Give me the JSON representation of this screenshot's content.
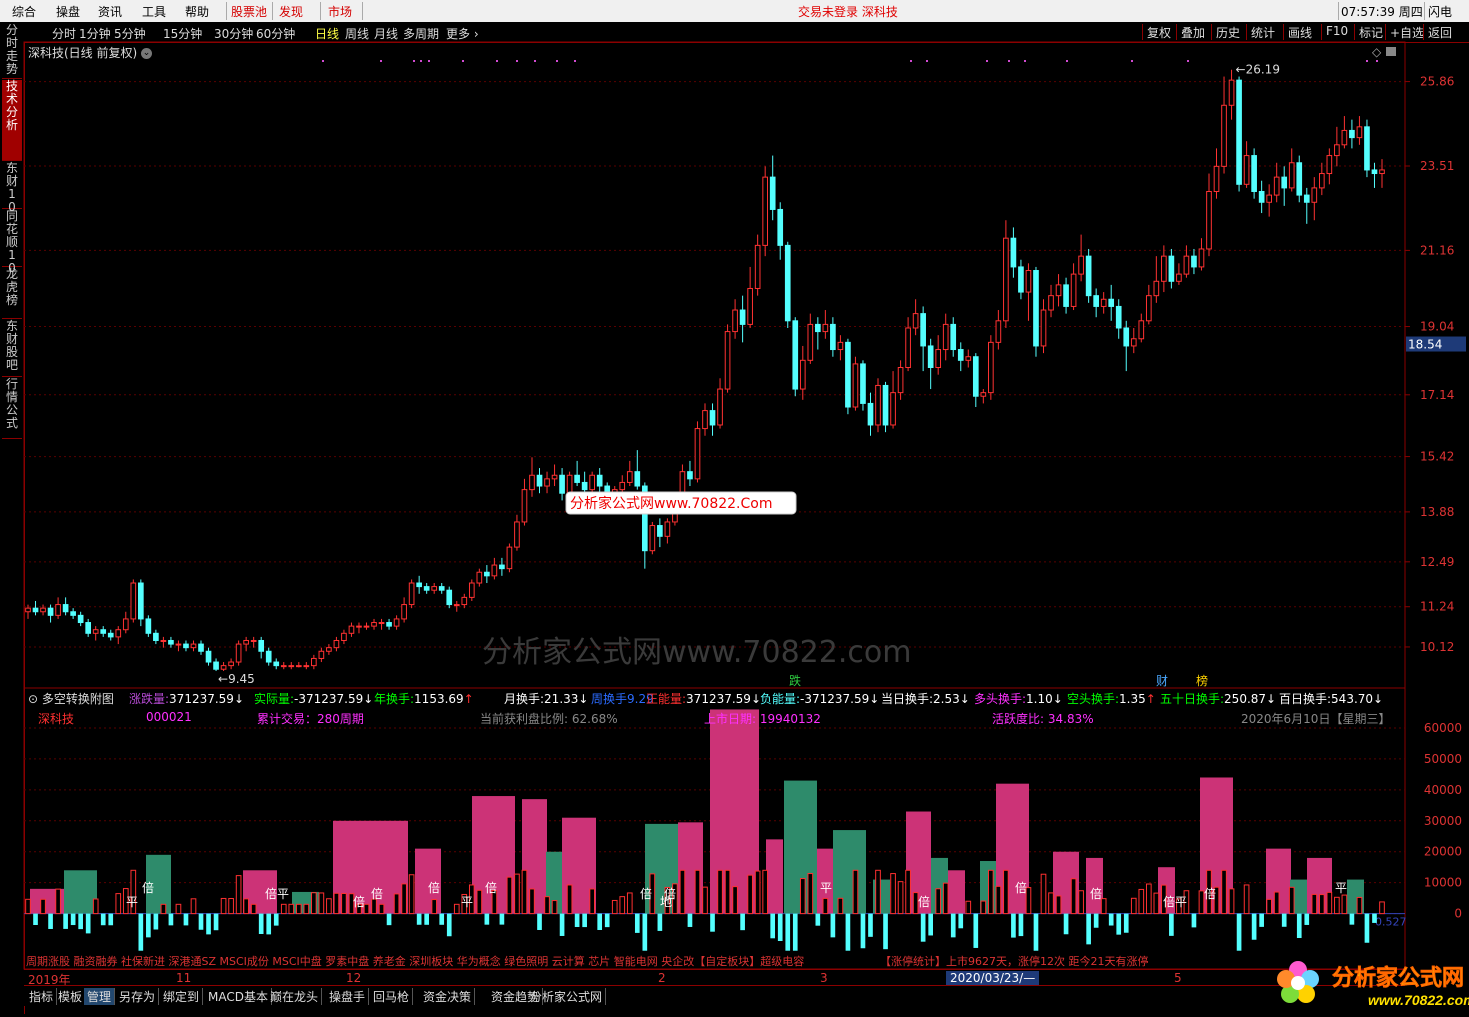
{
  "menubar": {
    "items": [
      "综合",
      "操盘",
      "资讯",
      "工具",
      "帮助"
    ],
    "red_items": [
      "股票池",
      "发现",
      "市场"
    ],
    "center_text": "交易未登录  深科技",
    "clock": "07:57:39 周四",
    "flash": "闪电"
  },
  "periodbar": {
    "periods": [
      "分时",
      "1分钟",
      "5分钟",
      "15分钟",
      "30分钟",
      "60分钟",
      "日线",
      "周线",
      "月线",
      "多周期",
      "更多"
    ],
    "active": "日线",
    "tools": [
      "复权",
      "叠加",
      "历史",
      "统计",
      "画线",
      "F10",
      "标记",
      "+自选",
      "返回"
    ]
  },
  "lefttabs": [
    "分时走势",
    "技术分析",
    "东财10",
    "同花顺10",
    "龙虎榜",
    "东财股吧",
    "行情公式"
  ],
  "chart": {
    "title": "深科技(日线 前复权)",
    "high_label": "26.19",
    "low_label": "9.45",
    "watermark_box": "分析家公式网www.70822.Com",
    "watermark_bg": "分析家公式网www.70822.com",
    "flags": [
      "跌",
      "财",
      "榜"
    ],
    "price_axis": [
      "25.86",
      "23.51",
      "21.16",
      "19.04",
      "17.14",
      "15.42",
      "13.88",
      "12.49",
      "11.24",
      "10.12"
    ],
    "current_price": "18.54",
    "colors": {
      "up": "#ff3232",
      "down": "#54ffff",
      "grid": "#5a0000",
      "vol_up": "#cc3377",
      "vol_down": "#2e8b6b"
    }
  },
  "candles": [
    [
      11.1,
      11.2,
      11.3,
      10.9
    ],
    [
      11.2,
      11.1,
      11.4,
      11.0
    ],
    [
      11.1,
      11.2,
      11.3,
      11.0
    ],
    [
      11.2,
      11.0,
      11.3,
      10.8
    ],
    [
      11.0,
      11.3,
      11.5,
      10.9
    ],
    [
      11.3,
      11.1,
      11.5,
      11.0
    ],
    [
      11.1,
      11.0,
      11.2,
      10.9
    ],
    [
      11.0,
      10.8,
      11.1,
      10.7
    ],
    [
      10.8,
      10.5,
      10.9,
      10.4
    ],
    [
      10.5,
      10.6,
      10.7,
      10.3
    ],
    [
      10.6,
      10.5,
      10.7,
      10.4
    ],
    [
      10.5,
      10.4,
      10.6,
      10.3
    ],
    [
      10.4,
      10.6,
      10.7,
      10.2
    ],
    [
      10.6,
      10.9,
      11.1,
      10.5
    ],
    [
      10.9,
      11.9,
      12.0,
      10.8
    ],
    [
      11.9,
      10.9,
      12.0,
      10.7
    ],
    [
      10.9,
      10.5,
      11.0,
      10.4
    ],
    [
      10.5,
      10.3,
      10.6,
      10.2
    ],
    [
      10.3,
      10.3,
      10.4,
      10.1
    ],
    [
      10.3,
      10.2,
      10.4,
      10.1
    ],
    [
      10.2,
      10.2,
      10.3,
      10.0
    ],
    [
      10.2,
      10.1,
      10.3,
      10.0
    ],
    [
      10.1,
      10.2,
      10.3,
      10.0
    ],
    [
      10.2,
      10.0,
      10.3,
      9.9
    ],
    [
      10.0,
      9.7,
      10.1,
      9.6
    ],
    [
      9.7,
      9.5,
      9.8,
      9.45
    ],
    [
      9.5,
      9.6,
      9.7,
      9.45
    ],
    [
      9.6,
      9.7,
      9.8,
      9.5
    ],
    [
      9.7,
      10.2,
      10.3,
      9.6
    ],
    [
      10.2,
      10.3,
      10.4,
      10.0
    ],
    [
      10.3,
      10.3,
      10.4,
      10.1
    ],
    [
      10.3,
      10.0,
      10.4,
      9.8
    ],
    [
      10.0,
      9.7,
      10.1,
      9.6
    ],
    [
      9.7,
      9.6,
      9.8,
      9.5
    ],
    [
      9.6,
      9.6,
      9.7,
      9.5
    ],
    [
      9.6,
      9.6,
      9.7,
      9.5
    ],
    [
      9.6,
      9.6,
      9.7,
      9.55
    ],
    [
      9.6,
      9.6,
      9.7,
      9.5
    ],
    [
      9.6,
      9.8,
      9.9,
      9.5
    ],
    [
      9.8,
      10.0,
      10.1,
      9.7
    ],
    [
      10.0,
      10.1,
      10.2,
      9.9
    ],
    [
      10.1,
      10.3,
      10.4,
      10.0
    ],
    [
      10.3,
      10.5,
      10.6,
      10.2
    ],
    [
      10.5,
      10.7,
      10.8,
      10.4
    ],
    [
      10.7,
      10.7,
      10.8,
      10.5
    ],
    [
      10.7,
      10.7,
      10.8,
      10.6
    ],
    [
      10.7,
      10.8,
      10.9,
      10.6
    ],
    [
      10.8,
      10.8,
      10.9,
      10.6
    ],
    [
      10.8,
      10.7,
      10.9,
      10.6
    ],
    [
      10.7,
      10.9,
      11.0,
      10.6
    ],
    [
      10.9,
      11.3,
      11.5,
      10.8
    ],
    [
      11.3,
      11.9,
      12.0,
      11.2
    ],
    [
      11.9,
      11.8,
      12.1,
      11.6
    ],
    [
      11.8,
      11.7,
      11.9,
      11.6
    ],
    [
      11.7,
      11.8,
      11.9,
      11.6
    ],
    [
      11.8,
      11.7,
      11.9,
      11.6
    ],
    [
      11.7,
      11.3,
      11.8,
      11.2
    ],
    [
      11.3,
      11.3,
      11.4,
      11.1
    ],
    [
      11.3,
      11.5,
      11.6,
      11.2
    ],
    [
      11.5,
      11.9,
      12.0,
      11.4
    ],
    [
      11.9,
      12.2,
      12.3,
      11.8
    ],
    [
      12.2,
      12.1,
      12.4,
      11.9
    ],
    [
      12.1,
      12.4,
      12.6,
      12.0
    ],
    [
      12.4,
      12.3,
      12.6,
      12.1
    ],
    [
      12.3,
      12.9,
      13.0,
      12.2
    ],
    [
      12.9,
      13.6,
      13.8,
      12.8
    ],
    [
      13.6,
      14.5,
      14.8,
      13.5
    ],
    [
      14.5,
      14.9,
      15.4,
      14.3
    ],
    [
      14.9,
      14.6,
      15.1,
      14.4
    ],
    [
      14.6,
      14.8,
      15.0,
      14.4
    ],
    [
      14.8,
      14.9,
      15.2,
      14.6
    ],
    [
      14.9,
      14.4,
      15.1,
      14.2
    ],
    [
      14.4,
      14.9,
      15.0,
      14.3
    ],
    [
      14.9,
      14.7,
      15.3,
      14.6
    ],
    [
      14.7,
      14.5,
      15.0,
      14.3
    ],
    [
      14.5,
      14.9,
      15.0,
      14.4
    ],
    [
      14.9,
      14.6,
      15.1,
      14.4
    ],
    [
      14.6,
      14.4,
      14.7,
      14.2
    ],
    [
      14.4,
      14.5,
      14.6,
      14.2
    ],
    [
      14.5,
      14.7,
      14.9,
      14.4
    ],
    [
      14.7,
      15.0,
      15.3,
      14.6
    ],
    [
      15.0,
      14.6,
      15.6,
      14.5
    ],
    [
      14.6,
      12.8,
      14.7,
      12.3
    ],
    [
      12.8,
      13.5,
      13.6,
      12.7
    ],
    [
      13.5,
      13.2,
      13.7,
      12.9
    ],
    [
      13.2,
      13.6,
      13.7,
      13.0
    ],
    [
      13.6,
      14.1,
      14.3,
      13.5
    ],
    [
      14.1,
      15.0,
      15.2,
      14.0
    ],
    [
      15.0,
      14.8,
      15.3,
      14.6
    ],
    [
      14.8,
      16.2,
      16.4,
      14.7
    ],
    [
      16.2,
      16.7,
      16.9,
      16.0
    ],
    [
      16.7,
      16.3,
      16.9,
      16.0
    ],
    [
      16.3,
      17.3,
      17.6,
      16.2
    ],
    [
      17.3,
      18.9,
      19.1,
      17.2
    ],
    [
      18.9,
      19.5,
      19.8,
      18.7
    ],
    [
      19.5,
      19.1,
      19.9,
      18.6
    ],
    [
      19.1,
      20.1,
      20.7,
      19.0
    ],
    [
      20.1,
      21.3,
      21.6,
      19.9
    ],
    [
      21.3,
      23.2,
      23.5,
      21.0
    ],
    [
      23.2,
      22.3,
      23.8,
      22.0
    ],
    [
      22.3,
      21.3,
      22.5,
      20.9
    ],
    [
      21.3,
      19.2,
      21.4,
      19.0
    ],
    [
      19.2,
      17.3,
      19.3,
      17.1
    ],
    [
      17.3,
      18.1,
      18.5,
      17.0
    ],
    [
      18.1,
      19.1,
      19.4,
      18.0
    ],
    [
      19.1,
      18.9,
      19.3,
      18.4
    ],
    [
      18.9,
      19.1,
      19.5,
      18.7
    ],
    [
      19.1,
      18.4,
      19.3,
      18.2
    ],
    [
      18.4,
      18.6,
      18.8,
      18.1
    ],
    [
      18.6,
      16.8,
      18.7,
      16.6
    ],
    [
      16.8,
      18.0,
      18.2,
      16.7
    ],
    [
      18.0,
      16.9,
      18.1,
      16.7
    ],
    [
      16.9,
      16.3,
      17.2,
      16.0
    ],
    [
      16.3,
      17.4,
      17.6,
      16.1
    ],
    [
      17.4,
      16.3,
      17.5,
      16.1
    ],
    [
      16.3,
      17.2,
      17.8,
      16.2
    ],
    [
      17.2,
      17.9,
      18.1,
      17.0
    ],
    [
      17.9,
      19.0,
      19.3,
      17.8
    ],
    [
      19.0,
      19.4,
      19.8,
      18.8
    ],
    [
      19.4,
      18.5,
      19.6,
      17.8
    ],
    [
      18.5,
      17.9,
      18.7,
      17.3
    ],
    [
      17.9,
      18.4,
      18.8,
      17.7
    ],
    [
      18.4,
      19.1,
      19.4,
      18.1
    ],
    [
      19.1,
      18.4,
      19.3,
      18.2
    ],
    [
      18.4,
      18.1,
      18.6,
      17.8
    ],
    [
      18.1,
      18.2,
      18.4,
      17.9
    ],
    [
      18.2,
      17.1,
      18.3,
      16.8
    ],
    [
      17.1,
      17.2,
      17.3,
      16.9
    ],
    [
      17.2,
      18.6,
      18.8,
      17.0
    ],
    [
      18.6,
      19.2,
      19.5,
      18.4
    ],
    [
      19.2,
      21.5,
      22.0,
      19.0
    ],
    [
      21.5,
      20.7,
      21.8,
      20.4
    ],
    [
      20.7,
      20.0,
      20.9,
      19.8
    ],
    [
      20.0,
      20.6,
      20.8,
      19.2
    ],
    [
      20.6,
      18.5,
      20.7,
      18.2
    ],
    [
      18.5,
      19.5,
      19.8,
      18.3
    ],
    [
      19.5,
      19.9,
      20.2,
      19.3
    ],
    [
      19.9,
      20.2,
      20.5,
      19.6
    ],
    [
      20.2,
      19.6,
      20.4,
      19.4
    ],
    [
      19.6,
      20.5,
      20.8,
      19.5
    ],
    [
      20.5,
      21.0,
      21.6,
      20.3
    ],
    [
      21.0,
      19.9,
      21.2,
      19.7
    ],
    [
      19.9,
      19.6,
      20.1,
      19.3
    ],
    [
      19.6,
      19.8,
      20.0,
      19.4
    ],
    [
      19.8,
      19.6,
      20.2,
      19.2
    ],
    [
      19.6,
      19.0,
      19.8,
      18.7
    ],
    [
      19.0,
      18.5,
      19.2,
      17.8
    ],
    [
      18.5,
      18.7,
      19.0,
      18.3
    ],
    [
      18.7,
      19.2,
      19.4,
      18.6
    ],
    [
      19.2,
      19.9,
      20.2,
      19.1
    ],
    [
      19.9,
      20.3,
      21.0,
      19.7
    ],
    [
      20.3,
      21.0,
      21.3,
      20.0
    ],
    [
      21.0,
      20.3,
      21.2,
      20.1
    ],
    [
      20.3,
      20.5,
      20.8,
      20.2
    ],
    [
      20.5,
      21.0,
      21.3,
      20.4
    ],
    [
      21.0,
      20.7,
      21.2,
      20.5
    ],
    [
      20.7,
      21.2,
      21.5,
      20.6
    ],
    [
      21.2,
      22.8,
      23.3,
      21.0
    ],
    [
      22.8,
      23.5,
      24.0,
      22.6
    ],
    [
      23.5,
      25.2,
      26.0,
      23.3
    ],
    [
      25.2,
      25.9,
      26.19,
      24.8
    ],
    [
      25.9,
      23.0,
      26.0,
      22.8
    ],
    [
      23.0,
      23.8,
      24.2,
      22.9
    ],
    [
      23.8,
      22.8,
      24.0,
      22.6
    ],
    [
      22.8,
      22.5,
      23.1,
      22.2
    ],
    [
      22.5,
      22.7,
      23.0,
      22.1
    ],
    [
      22.7,
      23.2,
      23.6,
      22.5
    ],
    [
      23.2,
      22.9,
      23.5,
      22.4
    ],
    [
      22.9,
      23.6,
      24.0,
      22.8
    ],
    [
      23.6,
      22.7,
      23.8,
      22.5
    ],
    [
      22.7,
      22.5,
      22.9,
      21.9
    ],
    [
      22.5,
      22.9,
      23.2,
      22.0
    ],
    [
      22.9,
      23.3,
      23.6,
      22.7
    ],
    [
      23.3,
      23.8,
      24.0,
      23.0
    ],
    [
      23.8,
      24.1,
      24.6,
      23.5
    ],
    [
      24.1,
      24.5,
      24.9,
      24.0
    ],
    [
      24.5,
      24.3,
      24.8,
      24.0
    ],
    [
      24.3,
      24.6,
      24.9,
      24.1
    ],
    [
      24.6,
      23.4,
      24.8,
      23.2
    ],
    [
      23.4,
      23.3,
      23.6,
      22.9
    ],
    [
      23.3,
      23.4,
      23.7,
      22.9
    ]
  ],
  "indicator": {
    "title": "多空转换附图",
    "items": [
      {
        "label": "涨跌量:",
        "value": "371237.59",
        "arrow": "↓",
        "color": "#b84bd6"
      },
      {
        "label": "实际量:",
        "value": "-371237.59",
        "arrow": "↓",
        "color": "#00ff00"
      },
      {
        "label": "年换手:",
        "value": "1153.69",
        "arrow": "↑",
        "color": "#00ff00"
      },
      {
        "label": "月换手:",
        "value": "21.33",
        "arrow": "↓",
        "color": "#ffffff"
      },
      {
        "label": "周换手",
        "value": "9.29",
        "arrow": "",
        "color": "#2b6bff"
      },
      {
        "label": "正能量:",
        "value": "371237.59",
        "arrow": "↓",
        "color": "#ff3030"
      },
      {
        "label": "负能量:",
        "value": "-371237.59",
        "arrow": "↓",
        "color": "#54ffff"
      },
      {
        "label": "当日换手:",
        "value": "2.53",
        "arrow": "↓",
        "color": "#ffffff"
      },
      {
        "label": "多头换手:",
        "value": "1.10",
        "arrow": "↓",
        "color": "#ff30ff"
      },
      {
        "label": "空头换手:",
        "value": "1.35",
        "arrow": "↑",
        "color": "#00ff00"
      },
      {
        "label": "五十日换手:",
        "value": "250.87",
        "arrow": "↓",
        "color": "#00ff00"
      },
      {
        "label": "百日换手:",
        "value": "543.70",
        "arrow": "↓",
        "color": "#ffffff"
      }
    ],
    "row2": {
      "name": "深科技",
      "code": "000021",
      "cum": "累计交易：280周期",
      "profit": "当前获利盘比例: 62.68%",
      "ipo": "上市日期: 19940132",
      "active": "活跃度比: 34.83%",
      "date": "2020年6月10日【星期三】"
    },
    "axis": [
      "60000",
      "50000",
      "40000",
      "30000",
      "20000",
      "10000",
      "0"
    ],
    "last_value": "0.527",
    "markers": [
      "平",
      "倍",
      "倍平",
      "倍",
      "倍",
      "倍",
      "平",
      "倍",
      "倍",
      "地",
      "倍",
      "平",
      "倍",
      "倍",
      "倍",
      "倍平",
      "倍",
      "平"
    ],
    "news_line": "周期涨股 融资融券 社保新进 深港通SZ MSCI成份 MSCI中盘 罗素中盘 养老金 深圳板块 华为概念 绿色照明 云计算 芯片 智能电网 央企改【自定板块】超级电容",
    "news_line2": "【涨停统计】上市9627天，涨停12次   距今21天有涨停"
  },
  "datestrip": {
    "labels": [
      "2019年",
      "11",
      "12",
      "2",
      "3",
      "2020/03/23/—",
      "5"
    ]
  },
  "bottomtabs": [
    "指标",
    "模板",
    "管理",
    "另存为",
    "绑定到",
    "MACD基本",
    "巅在龙头",
    "操盘手",
    "回马枪",
    "资金决策",
    "资金趋势",
    "分析家公式网"
  ],
  "bottom_active": "管理",
  "logo": {
    "text": "分析家公式网",
    "url": "www.70822.com"
  }
}
